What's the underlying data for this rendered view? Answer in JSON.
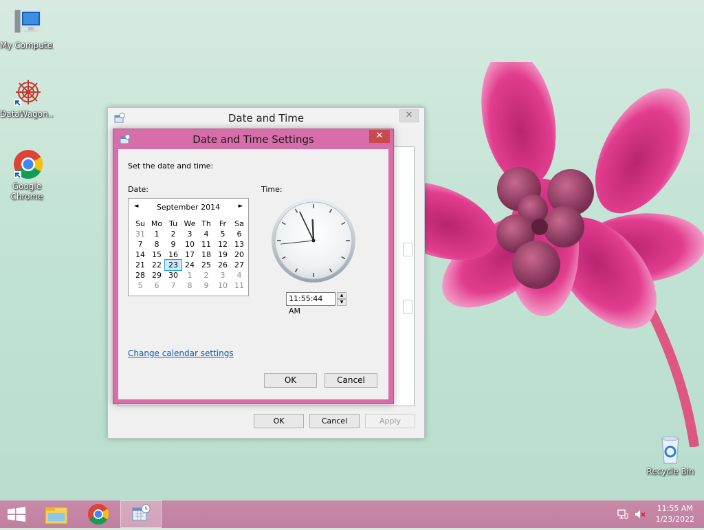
{
  "desktop": {
    "icons": [
      {
        "label": "My Computer",
        "icon": "computer-icon"
      },
      {
        "label": "DataWagon...",
        "icon": "datawagon-icon"
      },
      {
        "label": "Google Chrome",
        "icon": "chrome-icon"
      },
      {
        "label": "Recycle Bin",
        "icon": "recycle-bin-icon"
      }
    ]
  },
  "outer_window": {
    "title": "Date and Time",
    "close": "✕",
    "buttons": {
      "ok": "OK",
      "cancel": "Cancel",
      "apply": "Apply"
    }
  },
  "dialog": {
    "title": "Date and Time Settings",
    "close": "✕",
    "instruction": "Set the date and time:",
    "date_label": "Date:",
    "time_label": "Time:",
    "calendar": {
      "month": "September 2014",
      "prev": "◄",
      "next": "►",
      "weekdays": [
        "Su",
        "Mo",
        "Tu",
        "We",
        "Th",
        "Fr",
        "Sa"
      ],
      "weeks": [
        [
          "31",
          "1",
          "2",
          "3",
          "4",
          "5",
          "6"
        ],
        [
          "7",
          "8",
          "9",
          "10",
          "11",
          "12",
          "13"
        ],
        [
          "14",
          "15",
          "16",
          "17",
          "18",
          "19",
          "20"
        ],
        [
          "21",
          "22",
          "23",
          "24",
          "25",
          "26",
          "27"
        ],
        [
          "28",
          "29",
          "30",
          "1",
          "2",
          "3",
          "4"
        ],
        [
          "5",
          "6",
          "7",
          "8",
          "9",
          "10",
          "11"
        ]
      ],
      "selected_day": "23"
    },
    "clock": {
      "hours": 11,
      "minutes": 55,
      "seconds": 44
    },
    "time_value": "11:55:44 AM",
    "change_calendar_link": "Change calendar settings",
    "ok": "OK",
    "cancel": "Cancel"
  },
  "taskbar": {
    "items": [
      "start-icon",
      "file-explorer-icon",
      "chrome-icon",
      "date-time-app-icon"
    ],
    "time": "11:55 AM",
    "date": "1/23/2022"
  },
  "colors": {
    "dialog_frame": "#d76ea9",
    "taskbar": "#c27fa0",
    "close_button": "#c94a4a",
    "link": "#0b5aa8"
  }
}
